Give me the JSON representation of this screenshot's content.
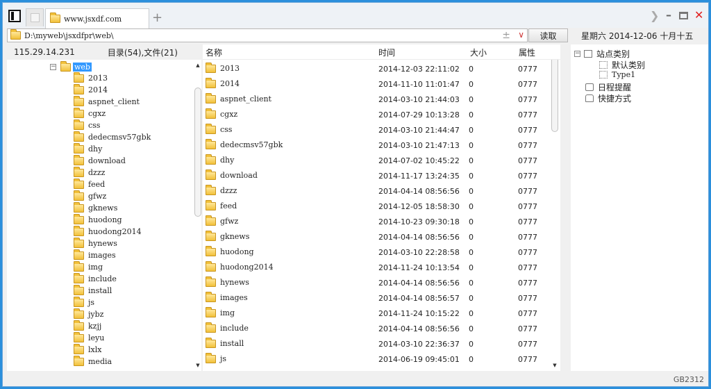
{
  "tabs": {
    "active_title": "www.jsxdf.com"
  },
  "address": {
    "path": "D:\\myweb\\jsxdfpr\\web\\",
    "read_button": "读取"
  },
  "date_display": "星期六 2014-12-06 十月十五",
  "left_header": {
    "ip": "115.29.14.231",
    "counts": "目录(54),文件(21)"
  },
  "tree": {
    "root": "web",
    "root_expander": "−",
    "items": [
      "2013",
      "2014",
      "aspnet_client",
      "cgxz",
      "css",
      "dedecmsv57gbk",
      "dhy",
      "download",
      "dzzz",
      "feed",
      "gfwz",
      "gknews",
      "huodong",
      "huodong2014",
      "hynews",
      "images",
      "img",
      "include",
      "install",
      "js",
      "jybz",
      "kzjj",
      "leyu",
      "lxlx",
      "media"
    ]
  },
  "columns": {
    "name": "名称",
    "time": "时间",
    "size": "大小",
    "attr": "属性"
  },
  "files": [
    {
      "name": "2013",
      "time": "2014-12-03 22:11:02",
      "size": "0",
      "attr": "0777"
    },
    {
      "name": "2014",
      "time": "2014-11-10 11:01:47",
      "size": "0",
      "attr": "0777"
    },
    {
      "name": "aspnet_client",
      "time": "2014-03-10 21:44:03",
      "size": "0",
      "attr": "0777"
    },
    {
      "name": "cgxz",
      "time": "2014-07-29 10:13:28",
      "size": "0",
      "attr": "0777"
    },
    {
      "name": "css",
      "time": "2014-03-10 21:44:47",
      "size": "0",
      "attr": "0777"
    },
    {
      "name": "dedecmsv57gbk",
      "time": "2014-03-10 21:47:13",
      "size": "0",
      "attr": "0777"
    },
    {
      "name": "dhy",
      "time": "2014-07-02 10:45:22",
      "size": "0",
      "attr": "0777"
    },
    {
      "name": "download",
      "time": "2014-11-17 13:24:35",
      "size": "0",
      "attr": "0777"
    },
    {
      "name": "dzzz",
      "time": "2014-04-14 08:56:56",
      "size": "0",
      "attr": "0777"
    },
    {
      "name": "feed",
      "time": "2014-12-05 18:58:30",
      "size": "0",
      "attr": "0777"
    },
    {
      "name": "gfwz",
      "time": "2014-10-23 09:30:18",
      "size": "0",
      "attr": "0777"
    },
    {
      "name": "gknews",
      "time": "2014-04-14 08:56:56",
      "size": "0",
      "attr": "0777"
    },
    {
      "name": "huodong",
      "time": "2014-03-10 22:28:58",
      "size": "0",
      "attr": "0777"
    },
    {
      "name": "huodong2014",
      "time": "2014-11-24 10:13:54",
      "size": "0",
      "attr": "0777"
    },
    {
      "name": "hynews",
      "time": "2014-04-14 08:56:56",
      "size": "0",
      "attr": "0777"
    },
    {
      "name": "images",
      "time": "2014-04-14 08:56:57",
      "size": "0",
      "attr": "0777"
    },
    {
      "name": "img",
      "time": "2014-11-24 10:15:22",
      "size": "0",
      "attr": "0777"
    },
    {
      "name": "include",
      "time": "2014-04-14 08:56:56",
      "size": "0",
      "attr": "0777"
    },
    {
      "name": "install",
      "time": "2014-03-10 22:36:37",
      "size": "0",
      "attr": "0777"
    },
    {
      "name": "js",
      "time": "2014-06-19 09:45:01",
      "size": "0",
      "attr": "0777"
    }
  ],
  "right_panel": {
    "site_category": "站点类别",
    "expander": "−",
    "default_category": "默认类别",
    "type1": "Type1",
    "schedule": "日程提醒",
    "shortcuts": "快捷方式"
  },
  "status": {
    "encoding": "GB2312"
  },
  "colors": {
    "desktop": "#2b8fdc",
    "selection": "#3399ff",
    "close": "#e02020",
    "folder": "#f2c13a"
  }
}
